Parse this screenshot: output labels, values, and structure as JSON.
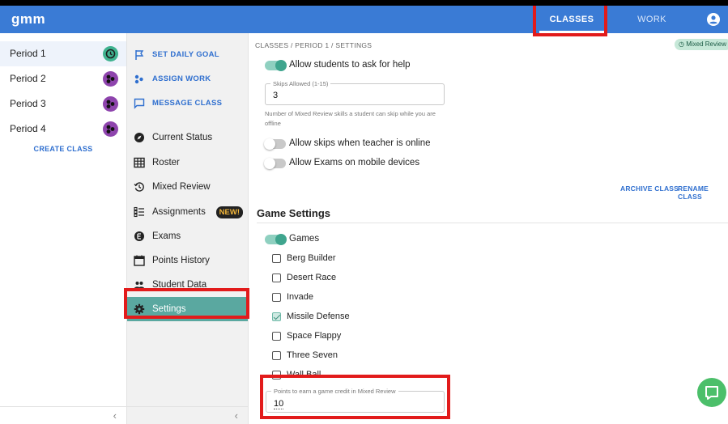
{
  "app": {
    "logo": "gmm",
    "nav": {
      "classes": "CLASSES",
      "work": "WORK"
    }
  },
  "periods": [
    {
      "label": "Period 1",
      "active": true
    },
    {
      "label": "Period 2",
      "active": false
    },
    {
      "label": "Period 3",
      "active": false
    },
    {
      "label": "Period 4",
      "active": false
    }
  ],
  "create_class": "CREATE CLASS",
  "menu": {
    "set_daily_goal": "SET DAILY GOAL",
    "assign_work": "ASSIGN WORK",
    "message_class": "MESSAGE CLASS",
    "current_status": "Current Status",
    "roster": "Roster",
    "mixed_review": "Mixed Review",
    "assignments": "Assignments",
    "new_badge": "NEW!",
    "exams": "Exams",
    "points_history": "Points History",
    "student_data": "Student Data",
    "settings": "Settings"
  },
  "main": {
    "breadcrumb": "CLASSES / PERIOD 1 / SETTINGS",
    "mode_badge": "Mixed Review",
    "allow_help": {
      "label": "Allow students to ask for help",
      "on": true
    },
    "skips_field": {
      "label": "Skips Allowed (1-15)",
      "value": "3"
    },
    "skips_help": "Number of Mixed Review skills a student can skip while you are offline",
    "allow_skips_online": {
      "label": "Allow skips when teacher is online",
      "on": false
    },
    "allow_exams_mobile": {
      "label": "Allow Exams on mobile devices",
      "on": false
    },
    "archive_class": "ARCHIVE CLASS",
    "rename_class": "RENAME CLASS",
    "game_settings_title": "Game Settings",
    "games_toggle": {
      "label": "Games",
      "on": true
    },
    "games": [
      {
        "label": "Berg Builder",
        "checked": false
      },
      {
        "label": "Desert Race",
        "checked": false
      },
      {
        "label": "Invade",
        "checked": false
      },
      {
        "label": "Missile Defense",
        "checked": true
      },
      {
        "label": "Space Flappy",
        "checked": false
      },
      {
        "label": "Three Seven",
        "checked": false
      },
      {
        "label": "Wall Ball",
        "checked": false
      }
    ],
    "points_field": {
      "label": "Points to earn a game credit in Mixed Review",
      "value": "10"
    }
  },
  "colors": {
    "topbar": "#3a7bd5",
    "accent_link": "#2f6fcf",
    "selected_menu": "#5aa8a0",
    "toggle_on": "#3fa58e",
    "highlight": "#e21b1b",
    "chat": "#4cbf6a"
  },
  "icons": {
    "account": "account-circle-icon",
    "flag": "flag-icon",
    "assign": "people-dots-icon",
    "message": "message-icon",
    "status": "compass-icon",
    "roster": "grid-icon",
    "history": "history-icon",
    "assignments": "list-icon",
    "exams": "exam-icon",
    "calendar": "calendar-icon",
    "people": "people-icon",
    "gear": "gear-icon",
    "chat": "chat-icon"
  }
}
